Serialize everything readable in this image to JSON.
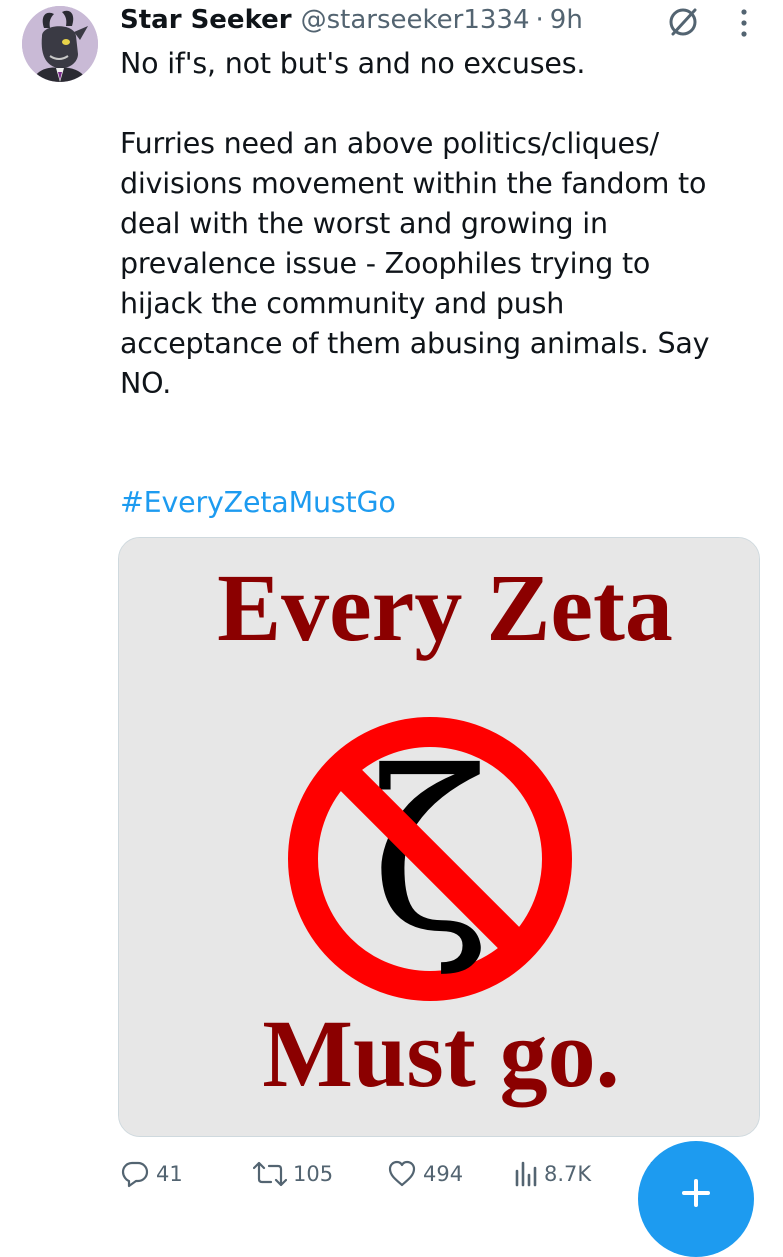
{
  "tweet": {
    "display_name": "Star Seeker",
    "handle": "@starseeker1334",
    "separator": "·",
    "time": "9h",
    "text": "No if's, not but's and no excuses.\n\nFurries need an above politics/cliques/\ndivisions movement within the fandom to\ndeal with the worst and growing in\nprevalence issue - Zoophiles trying to\nhijack the community and push\nacceptance of them abusing animals. Say\nNO.",
    "hashtag": "#EveryZetaMustGo",
    "image": {
      "line1": "Every Zeta",
      "line2": "Must go.",
      "symbol": "ζ",
      "text_color": "#8b0000",
      "sign_color": "#ff0000"
    }
  },
  "actions": {
    "replies": "41",
    "reposts": "105",
    "likes": "494",
    "views": "8.7K"
  },
  "colors": {
    "accent": "#1d9bf0",
    "muted": "#536471"
  }
}
